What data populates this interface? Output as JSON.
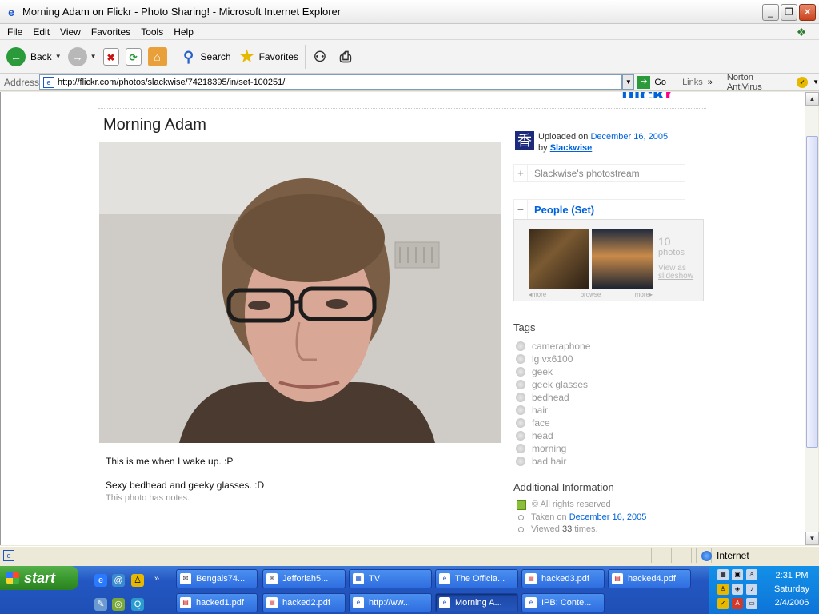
{
  "window": {
    "title": "Morning Adam on Flickr - Photo Sharing! - Microsoft Internet Explorer"
  },
  "menu": [
    "File",
    "Edit",
    "View",
    "Favorites",
    "Tools",
    "Help"
  ],
  "toolbar": {
    "back": "Back",
    "search": "Search",
    "favorites": "Favorites"
  },
  "address": {
    "label": "Address",
    "url": "http://flickr.com/photos/slackwise/74218395/in/set-100251/",
    "go": "Go",
    "links": "Links",
    "chevron": "»",
    "norton": "Norton AntiVirus"
  },
  "page": {
    "logo_main": "flick",
    "logo_r": "r",
    "title": "Morning Adam",
    "desc1": "This is me when I wake up. :P",
    "desc2": "Sexy bedhead and geeky glasses. :D",
    "notes": "This photo has notes.",
    "uploaded_prefix": "Uploaded on",
    "uploaded_date": "December 16, 2005",
    "by": "by",
    "owner": "Slackwise",
    "avatar_char": "香",
    "photostream": "Slackwise's photostream",
    "set_title": "People (Set)",
    "set_count": "10",
    "set_count_label": "photos",
    "view_as": "View as",
    "slideshow": "slideshow",
    "set_nav": {
      "more_left": "more",
      "browse": "browse",
      "more_right": "more"
    },
    "tags_heading": "Tags",
    "tags": [
      "cameraphone",
      "lg vx6100",
      "geek",
      "geek glasses",
      "bedhead",
      "hair",
      "face",
      "head",
      "morning",
      "bad hair"
    ],
    "additional_heading": "Additional Information",
    "rights": "© All rights reserved",
    "taken_prefix": "Taken on",
    "taken_date": "December 16, 2005",
    "viewed_prefix": "Viewed",
    "viewed_count": "33",
    "viewed_suffix": "times."
  },
  "status": {
    "zone": "Internet"
  },
  "taskbar": {
    "start": "start",
    "tasks_row1": [
      "Bengals74...",
      "Jefforiah5...",
      "TV",
      "The Officia...",
      "hacked3.pdf",
      "hacked4.pdf"
    ],
    "tasks_row2": [
      "hacked1.pdf",
      "hacked2.pdf",
      "http://ww...",
      "Morning A...",
      "IPB: Conte..."
    ],
    "clock_time": "2:31 PM",
    "clock_day": "Saturday",
    "clock_date": "2/4/2006"
  }
}
